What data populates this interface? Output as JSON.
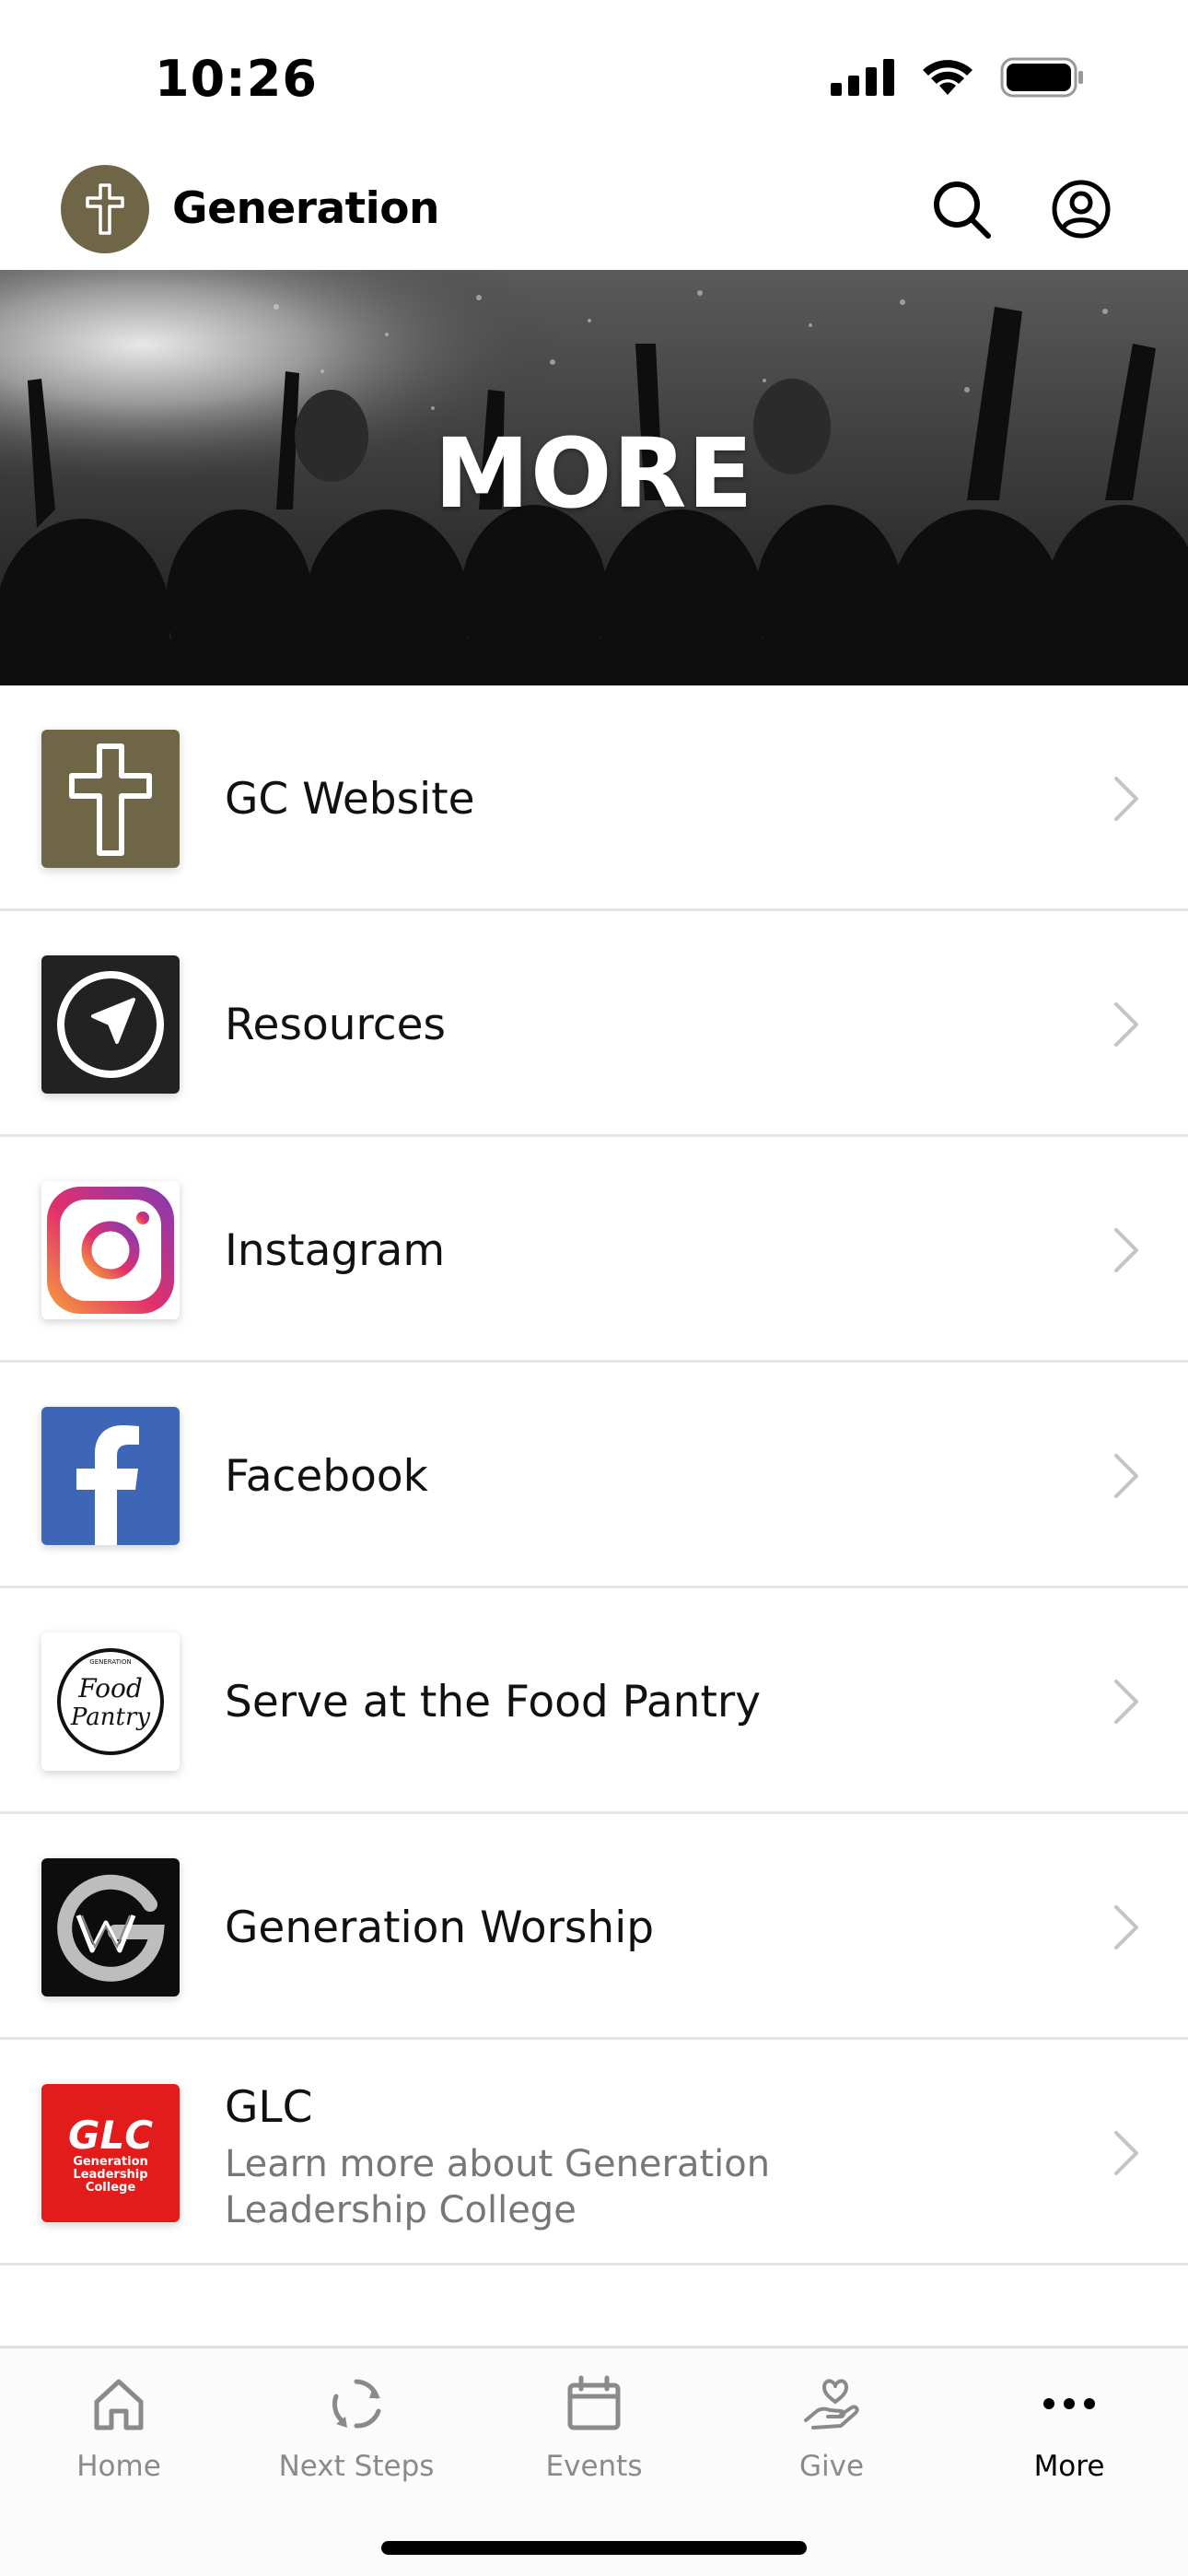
{
  "status_bar": {
    "time": "10:26",
    "icons": [
      "cellular-signal-icon",
      "wifi-icon",
      "battery-icon"
    ]
  },
  "header": {
    "app_title": "Generation",
    "logo_icon": "cross-icon",
    "search_icon": "search-icon",
    "account_icon": "account-icon",
    "logo_color": "#6e6647"
  },
  "hero": {
    "title": "MORE"
  },
  "list": {
    "items": [
      {
        "label": "GC Website",
        "subtitle": "",
        "icon": "cross-logo"
      },
      {
        "label": "Resources",
        "subtitle": "",
        "icon": "navigation-arrow-logo"
      },
      {
        "label": "Instagram",
        "subtitle": "",
        "icon": "instagram-logo"
      },
      {
        "label": "Facebook",
        "subtitle": "",
        "icon": "facebook-logo"
      },
      {
        "label": "Serve at the Food Pantry",
        "subtitle": "",
        "icon": "food-pantry-logo",
        "logo_text": [
          "GENERATION",
          "Food",
          "Pantry"
        ]
      },
      {
        "label": "Generation Worship",
        "subtitle": "",
        "icon": "generation-worship-logo"
      },
      {
        "label": "GLC",
        "subtitle": "Learn more about Generation Leadership College",
        "icon": "glc-logo",
        "logo_text": [
          "GLC",
          "Generation",
          "Leadership",
          "College"
        ]
      }
    ]
  },
  "tab_bar": {
    "tabs": [
      {
        "label": "Home",
        "icon": "home-icon",
        "active": false
      },
      {
        "label": "Next Steps",
        "icon": "next-steps-icon",
        "active": false
      },
      {
        "label": "Events",
        "icon": "calendar-icon",
        "active": false
      },
      {
        "label": "Give",
        "icon": "give-icon",
        "active": false
      },
      {
        "label": "More",
        "icon": "more-icon",
        "active": true
      }
    ]
  },
  "colors": {
    "gc_brand": "#6e6647",
    "facebook_blue": "#3d67b6",
    "glc_red": "#e21b1b",
    "tab_inactive": "#8a8a8a",
    "tab_active": "#000000"
  }
}
